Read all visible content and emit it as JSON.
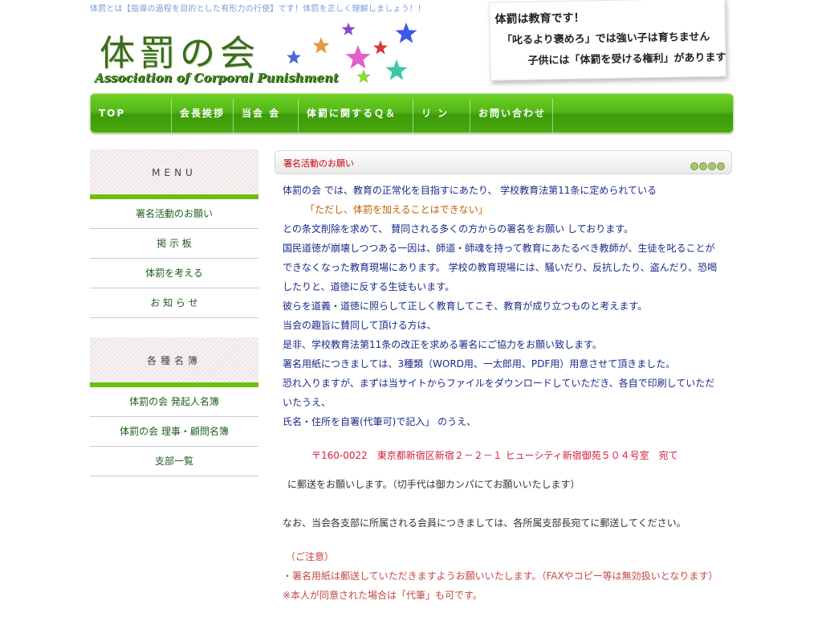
{
  "header": {
    "tagline": "体罰とは【指導の過程を目的とした有形力の行使】です！体罰を正しく理解しましょう！！",
    "logo_text": "体罰の会",
    "logo_subtext": "Association of Corporal Punishment",
    "note_lines": [
      "体罰は教育です！",
      "「叱るより褒めろ」では強い子は育ちません",
      "子供には「体罰を受ける権利」があります"
    ]
  },
  "nav": {
    "items": [
      "TOP",
      "会長挨拶",
      "当会 会",
      "体罰に関するＱ＆",
      "リ ン",
      "お問い合わせ"
    ]
  },
  "sidebar": {
    "menu_title": "MENU",
    "menu_items": [
      "署名活動のお願い",
      "掲 示 板",
      "体罰を考える",
      "お 知 ら せ"
    ],
    "roster_title": "各種名簿",
    "roster_items": [
      "体罰の会 発起人名簿",
      "体罰の会 理事・顧問名簿",
      "支部一覧"
    ]
  },
  "content": {
    "title": "署名活動のお願い",
    "line1": "体罰の会 では、教育の正常化を目指すにあたり、 学校教育法第11条に定められている",
    "quote": "「ただし、体罰を加えることはできない」",
    "line2": "との条文削除を求めて、 賛同される多くの方からの署名をお願い しております。",
    "line3": "国民道徳が崩壊しつつある一因は、師道・師魂を持って教育にあたるべき教師が、生徒を叱ることが",
    "line4": "できなくなった教育現場にあります。 学校の教育現場には、騒いだり、反抗したり、盗んだり、恐喝",
    "line5": "したりと、道徳に反する生徒もいます。",
    "line6": "彼らを道義・道徳に照らして正しく教育してこそ、教育が成り立つものと考えます。",
    "line7": "当会の趣旨に賛同して頂ける方は、",
    "line8": "是非、学校教育法第11条の改正を求める署名にご協力をお願い致します。",
    "line9": "署名用紙につきましては、3種類（WORD用、一太郎用、PDF用）用意させて頂きました。",
    "line10": "恐れ入りますが、まずは当サイトからファイルをダウンロードしていただき、各自で印刷していただ",
    "line11": "いたうえ、",
    "line12": "氏名・住所を自署(代筆可)で記入」 のうえ、",
    "address": "〒160-0022　東京都新宿区新宿２－２－１ ヒューシティ新宿御苑５０４号室　宛て",
    "mail_request": "に郵送をお願いします。（切手代は御カンパにてお願いいたします）",
    "branch_note": "なお、当会各支部に所属される会員につきましては、各所属支部長宛てに郵送してください。",
    "caution_title": "（ご注意）",
    "caution1": "・署名用紙は郵送していただきますようお願いいたします。（FAXやコピー等は無効扱いとなります）",
    "caution2": "※本人が同意された場合は「代筆」も可です。"
  },
  "colors": {
    "nav_green": "#4aaa10",
    "accent_green": "#6cbf0c",
    "title_red": "#c8000c",
    "body_blue": "#1a2a8a"
  }
}
